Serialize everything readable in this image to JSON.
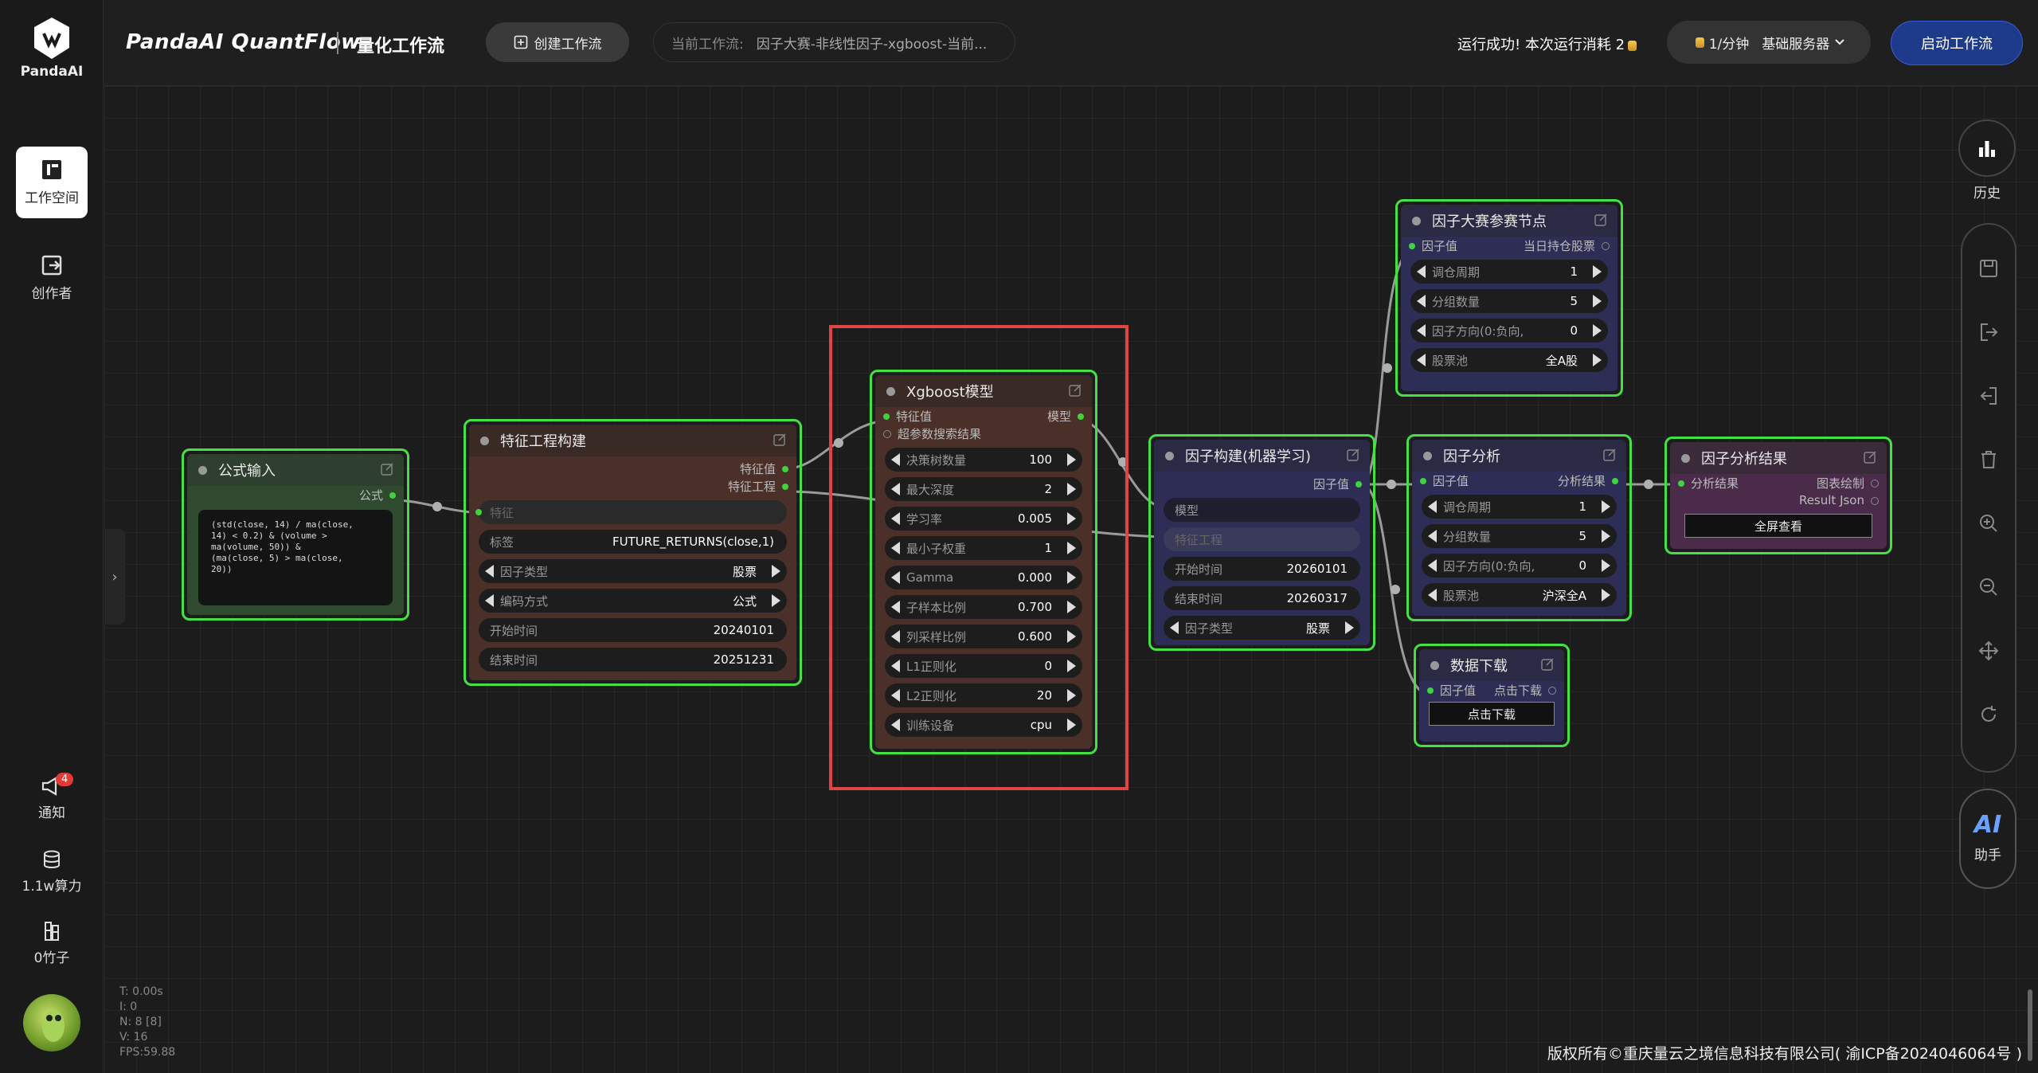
{
  "sidebar": {
    "logo_text": "PandaAI",
    "workspace": "工作空间",
    "creator": "创作者",
    "notify": "通知",
    "notify_count": "4",
    "compute": "1.1w算力",
    "bamboo": "0竹子"
  },
  "topbar": {
    "brand": "PandaAI QuantFlow",
    "subtitle": "量化工作流",
    "create_label": "创建工作流",
    "current_label": "当前工作流:",
    "current_value": "因子大赛-非线性因子-xgboost-当前...",
    "run_status": "运行成功! 本次运行消耗 2",
    "server_rate": "1/分钟",
    "server_name": "基础服务器",
    "start_label": "启动工作流"
  },
  "right_toolbar": {
    "history": "历史",
    "ai_icon": "AI",
    "ai_label": "助手"
  },
  "nodes": {
    "formula": {
      "title": "公式输入",
      "out": "公式",
      "text": "(std(close, 14) / ma(close,\n14) < 0.2) & (volume >\nma(volume, 50)) &\n(ma(close, 5) > ma(close,\n20))"
    },
    "feature": {
      "title": "特征工程构建",
      "out1": "特征值",
      "out2": "特征工程",
      "in1": "特征",
      "p_label": "标签",
      "p_label_v": "FUTURE_RETURNS(close,1)",
      "p_type": "因子类型",
      "p_type_v": "股票",
      "p_enc": "编码方式",
      "p_enc_v": "公式",
      "p_start": "开始时间",
      "p_start_v": "20240101",
      "p_end": "结束时间",
      "p_end_v": "20251231"
    },
    "xgb": {
      "title": "Xgboost模型",
      "in1": "特征值",
      "in2": "超参数搜索结果",
      "out": "模型",
      "params": [
        {
          "k": "决策树数量",
          "v": "100"
        },
        {
          "k": "最大深度",
          "v": "2"
        },
        {
          "k": "学习率",
          "v": "0.005"
        },
        {
          "k": "最小子权重",
          "v": "1"
        },
        {
          "k": "Gamma",
          "v": "0.000"
        },
        {
          "k": "子样本比例",
          "v": "0.700"
        },
        {
          "k": "列采样比例",
          "v": "0.600"
        },
        {
          "k": "L1正则化",
          "v": "0"
        },
        {
          "k": "L2正则化",
          "v": "20"
        },
        {
          "k": "训练设备",
          "v": "cpu"
        }
      ]
    },
    "build": {
      "title": "因子构建(机器学习)",
      "out": "因子值",
      "in1": "模型",
      "in2": "特征工程",
      "p_start": "开始时间",
      "p_start_v": "20260101",
      "p_end": "结束时间",
      "p_end_v": "20260317",
      "p_type": "因子类型",
      "p_type_v": "股票"
    },
    "contest": {
      "title": "因子大赛参赛节点",
      "in": "因子值",
      "out": "当日持仓股票",
      "params": [
        {
          "k": "调仓周期",
          "v": "1"
        },
        {
          "k": "分组数量",
          "v": "5"
        },
        {
          "k": "因子方向(0:负向,",
          "v": "0"
        },
        {
          "k": "股票池",
          "v": "全A股"
        }
      ]
    },
    "analysis": {
      "title": "因子分析",
      "in": "因子值",
      "out": "分析结果",
      "params": [
        {
          "k": "调仓周期",
          "v": "1"
        },
        {
          "k": "分组数量",
          "v": "5"
        },
        {
          "k": "因子方向(0:负向,",
          "v": "0"
        },
        {
          "k": "股票池",
          "v": "沪深全A"
        }
      ]
    },
    "result": {
      "title": "因子分析结果",
      "in": "分析结果",
      "out1": "图表绘制",
      "out2": "Result Json",
      "btn": "全屏查看"
    },
    "download": {
      "title": "数据下载",
      "in": "因子值",
      "out": "点击下载",
      "btn": "点击下载"
    }
  },
  "stats": {
    "t": "T: 0.00s",
    "i": "I: 0",
    "n": "N: 8 [8]",
    "v": "V: 16",
    "fps": "FPS:59.88"
  },
  "copyright": "版权所有©重庆量云之境信息科技有限公司( 渝ICP备2024046064号 )",
  "colors": {
    "node_border": "#45e045",
    "formula_bg": "#2f4a2f",
    "feature_bg": "#4a3028",
    "xgb_bg": "#4a3028",
    "build_bg": "#2d2d55",
    "analysis_bg": "#2d2d55",
    "result_bg": "#4a2c4a",
    "highlight": "#e04545"
  }
}
